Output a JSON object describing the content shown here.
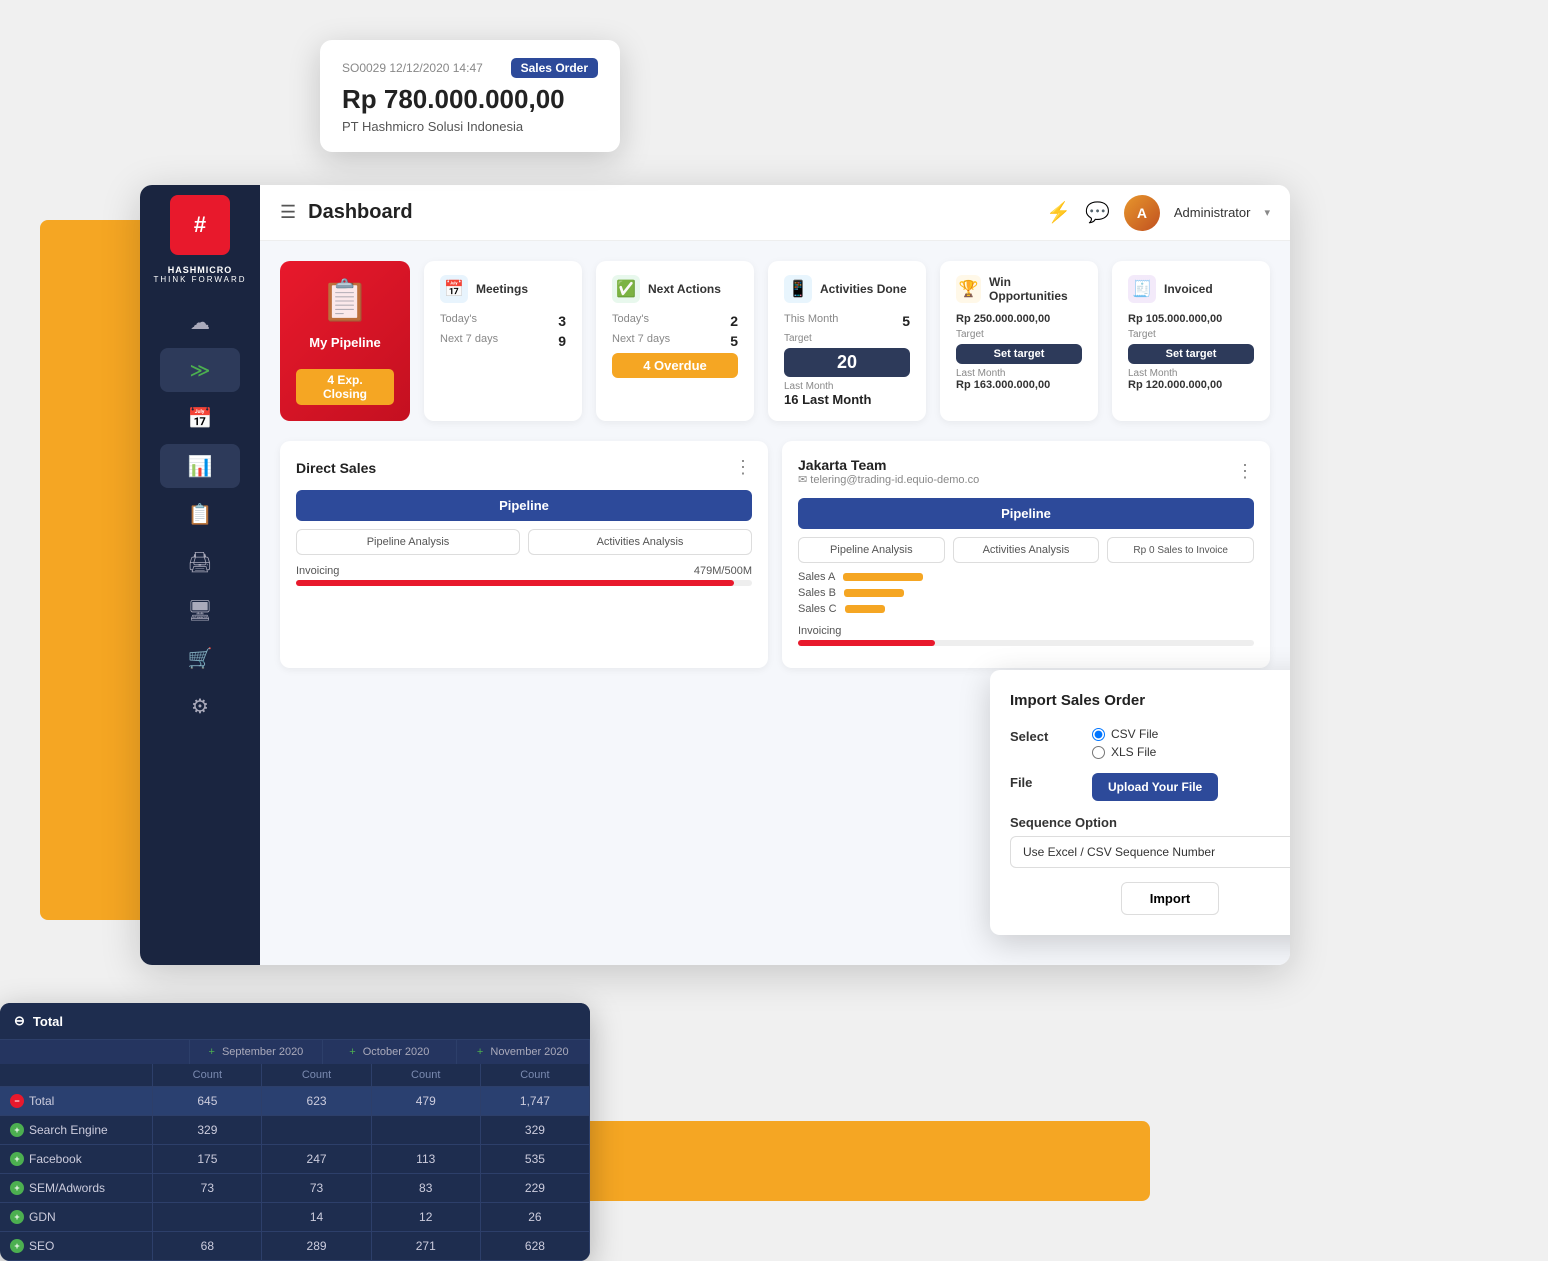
{
  "app": {
    "title": "Dashboard",
    "user": "Administrator",
    "logo_text": "#",
    "brand_name": "HASHMICRO",
    "brand_tagline": "THINK FORWARD"
  },
  "tooltip": {
    "ref": "SO0029 12/12/2020 14:47",
    "badge": "Sales Order",
    "amount": "Rp 780.000.000,00",
    "company": "PT Hashmicro Solusi Indonesia"
  },
  "pipeline_card": {
    "label": "My Pipeline",
    "exp_closing": "4  Exp. Closing"
  },
  "meetings_card": {
    "icon_color": "#4a90d9",
    "title": "Meetings",
    "today_label": "Today's",
    "today_value": "3",
    "next7_label": "Next 7 days",
    "next7_value": "9"
  },
  "next_actions_card": {
    "icon_color": "#4CAF50",
    "title": "Next Actions",
    "today_label": "Today's",
    "today_value": "2",
    "next7_label": "Next 7 days",
    "next7_value": "5",
    "overdue_label": "4  Overdue"
  },
  "activities_done_card": {
    "icon_color": "#2d9cdb",
    "title": "Activities Done",
    "this_month_label": "This Month",
    "this_month_value": "5",
    "target_label": "Target",
    "target_value": "20",
    "last_month_label": "Last Month",
    "last_month_value": "16"
  },
  "win_opps_card": {
    "icon_color": "#F5A623",
    "title": "Win Opportunities",
    "value": "Rp 250.000.000,00",
    "target_label": "Target",
    "target_btn": "Set target",
    "last_month_label": "Last Month",
    "last_month_value": "Rp 163.000.000,00"
  },
  "invoiced_card": {
    "icon_color": "#9b59b6",
    "title": "Invoiced",
    "value": "Rp 105.000.000,00",
    "target_label": "Target",
    "target_btn": "Set target",
    "last_month_label": "Last Month",
    "last_month_value": "Rp 120.000.000,00"
  },
  "direct_sales": {
    "title": "Direct Sales",
    "pipeline_btn": "Pipeline",
    "pipeline_analysis_btn": "Pipeline Analysis",
    "activities_analysis_btn": "Activities Analysis",
    "invoicing_label": "Invoicing",
    "invoicing_value": "479M/500M"
  },
  "jakarta_team": {
    "title": "Jakarta Team",
    "email": "telering@trading-id.equio-demo.co",
    "pipeline_btn": "Pipeline",
    "pipeline_analysis_btn": "Pipeline Analysis",
    "activities_analysis_btn": "Activities Analysis",
    "sales_invoice_btn": "Rp 0 Sales to Invoice",
    "sales_a": "Sales A",
    "sales_b": "Sales B",
    "sales_c": "Sales C",
    "invoicing_label": "Invoicing"
  },
  "import_dialog": {
    "title": "Import Sales Order",
    "select_label": "Select",
    "csv_label": "CSV File",
    "xls_label": "XLS File",
    "file_label": "File",
    "upload_btn": "Upload Your File",
    "sequence_label": "Sequence Option",
    "sequence_value": "Use Excel / CSV Sequence Number",
    "import_btn": "Import"
  },
  "data_table": {
    "header": "Total",
    "col_sep2020": "September 2020",
    "col_oct2020": "October 2020",
    "col_nov2020": "November 2020",
    "col_count": "Count",
    "rows": [
      {
        "label": "Total",
        "icon": "minus",
        "sep": "645",
        "oct": "623",
        "nov": "479",
        "count": "1,747"
      },
      {
        "label": "Search Engine",
        "icon": "plus",
        "sep": "329",
        "oct": "",
        "nov": "",
        "count": "329"
      },
      {
        "label": "Facebook",
        "icon": "plus",
        "sep": "175",
        "oct": "247",
        "nov": "113",
        "count": "535"
      },
      {
        "label": "SEM/Adwords",
        "icon": "plus",
        "sep": "73",
        "oct": "73",
        "nov": "83",
        "count": "229"
      },
      {
        "label": "GDN",
        "icon": "plus",
        "sep": "",
        "oct": "14",
        "nov": "12",
        "count": "26"
      },
      {
        "label": "SEO",
        "icon": "plus",
        "sep": "68",
        "oct": "289",
        "nov": "271",
        "count": "628"
      }
    ]
  },
  "sidebar": {
    "items": [
      {
        "icon": "☁",
        "name": "cloud"
      },
      {
        "icon": "≫",
        "name": "chevron-right"
      },
      {
        "icon": "📅",
        "name": "calendar"
      },
      {
        "icon": "📊",
        "name": "chart"
      },
      {
        "icon": "📋",
        "name": "list"
      },
      {
        "icon": "🖨",
        "name": "print"
      },
      {
        "icon": "🖥",
        "name": "monitor"
      },
      {
        "icon": "🛒",
        "name": "cart"
      },
      {
        "icon": "🔧",
        "name": "settings"
      }
    ]
  }
}
